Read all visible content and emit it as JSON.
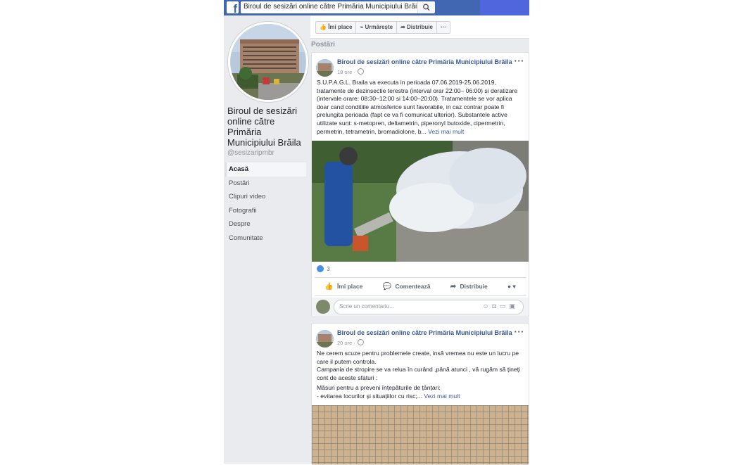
{
  "topbar": {
    "logo": "f",
    "search_value": "Biroul de sesizări online către Primăria Municipiului Brăila"
  },
  "page_info": {
    "name": "Biroul de sesizări online către Primăria Municipiului Brăila",
    "handle": "@sesizaripmbr"
  },
  "nav": {
    "items": [
      {
        "label": "Acasă"
      },
      {
        "label": "Postări"
      },
      {
        "label": "Clipuri video"
      },
      {
        "label": "Fotografii"
      },
      {
        "label": "Despre"
      },
      {
        "label": "Comunitate"
      }
    ]
  },
  "actions": {
    "like": "Îmi place",
    "follow": "Urmărește",
    "share": "Distribuie",
    "more": "···"
  },
  "section_title": "Postări",
  "posts": [
    {
      "author": "Biroul de sesizări online către Primăria Municipiului Brăila",
      "time": "18 ore ·",
      "more": "···",
      "body": "S.U.P.A.G.L. Braila va executa in perioada 07.06.2019-25.06.2019, tratamente de dezinsectie terestra (interval orar 22:00– 06:00) si deratizare (intervale orare: 08:30–12:00 si 14:00–20:00). Tratamentele se vor aplica doar cand conditiile atmosferice sunt favorabile, in caz contrar poate fi prelungita perioada (fapt ce va fi comunicat ulterior). Substantele active utilizate sunt: s-metopren, deltametrin, piperonyl butoxide, cipermetrin, permetrin, tetrametrin, bromadiolone, b...",
      "see_more": "Vezi mai mult",
      "reactions_count": "3",
      "like_label": "Îmi place",
      "comment_label": "Comentează",
      "share_label": "Distribuie",
      "comment_placeholder": "Scrie un comentariu..."
    },
    {
      "author": "Biroul de sesizări online către Primăria Municipiului Brăila",
      "time": "20 ore ·",
      "more": "···",
      "body_p1": "Ne cerem scuze pentru problemele create, insă vremea nu este un lucru pe care il putem controla.",
      "body_p2": "Campania de stropire se va relua în curând ,până atunci , vă rugăm să țineți cont de aceste sfaturi :",
      "body_p3": "Măsuri pentru a preveni înțepăturile de țânțari:",
      "body_p4": "- evitarea locurilor și situațiilor cu risc;...",
      "see_more": "Vezi mai mult"
    }
  ],
  "colors": {
    "brand": "#4267b2",
    "link": "#385898",
    "background": "#e9ebee"
  }
}
